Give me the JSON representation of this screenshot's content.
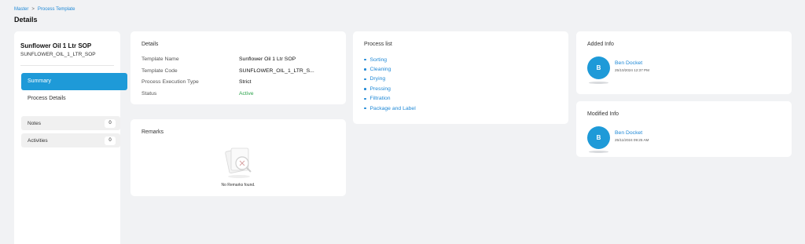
{
  "breadcrumb": {
    "root": "Master",
    "separator": ">",
    "current": "Process Template"
  },
  "page_title": "Details",
  "sidebar": {
    "title": "Sunflower Oil 1 Ltr SOP",
    "code": "SUNFLOWER_OIL_1_LTR_SOP",
    "active_item": "Summary",
    "process_details": "Process Details",
    "notes": {
      "label": "Notes",
      "count": "0"
    },
    "activities": {
      "label": "Activities",
      "count": "0"
    }
  },
  "details": {
    "heading": "Details",
    "rows": [
      {
        "key": "Template Name",
        "value": "Sunflower Oil 1 Ltr SOP"
      },
      {
        "key": "Template Code",
        "value": "SUNFLOWER_OIL_1_LTR_S..."
      },
      {
        "key": "Process Execution Type",
        "value": "Strict"
      },
      {
        "key": "Status",
        "value": "Active"
      }
    ],
    "status_color": "#2aa24a"
  },
  "remarks": {
    "heading": "Remarks",
    "empty_text": "No Remarks found."
  },
  "process_list": {
    "heading": "Process list",
    "items": [
      "Sorting",
      "Cleaning",
      "Drying",
      "Pressing",
      "Filtration",
      "Package and Label"
    ]
  },
  "added_info": {
    "heading": "Added Info",
    "initial": "B",
    "name": "Ben Docket",
    "date": "25/10/2024 12:37 PM"
  },
  "modified_info": {
    "heading": "Modified Info",
    "initial": "B",
    "name": "Ben Docket",
    "date": "25/11/2024 09:25 AM"
  },
  "colors": {
    "accent": "#1e9ad8",
    "link": "#1e88d6",
    "background": "#f1f2f4"
  }
}
